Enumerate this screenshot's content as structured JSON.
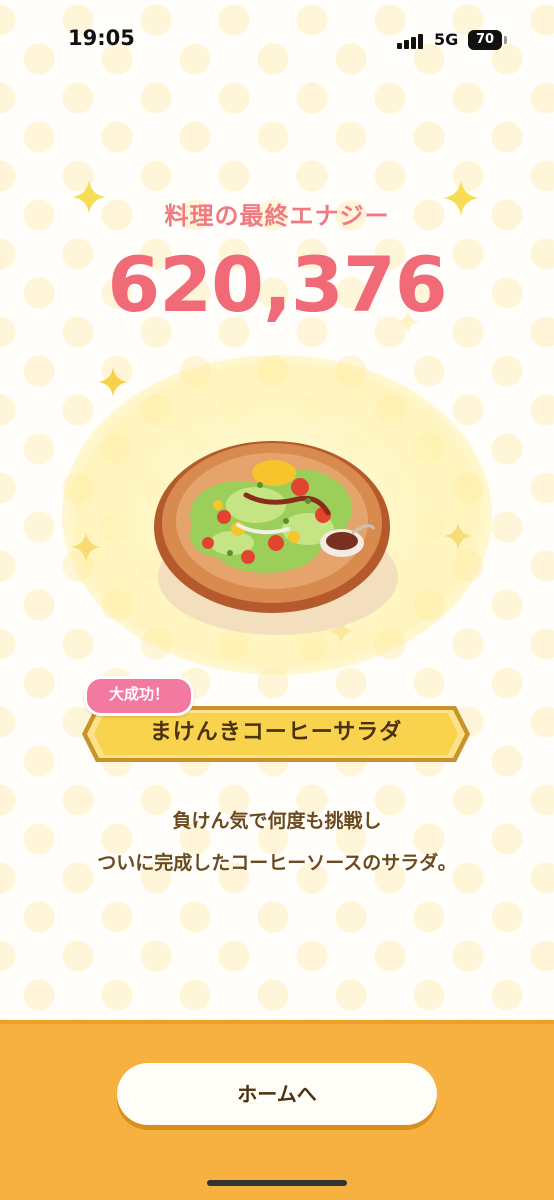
{
  "status_bar": {
    "time": "19:05",
    "network": "5G",
    "battery": "70"
  },
  "result": {
    "energy_label": "料理の最終エナジー",
    "energy_value": "620,376"
  },
  "dish": {
    "badge": "大成功！",
    "name": "まけんきコーヒーサラダ",
    "description_line1": "負けん気で何度も挑戦し",
    "description_line2": "ついに完成したコーヒーソースのサラダ。"
  },
  "footer": {
    "home_button_label": "ホームへ"
  },
  "colors": {
    "energy_pink": "#f06a77",
    "badge_pink": "#f27aa0",
    "plate_gold": "#f9d34d",
    "footer_orange": "#f6b140"
  }
}
